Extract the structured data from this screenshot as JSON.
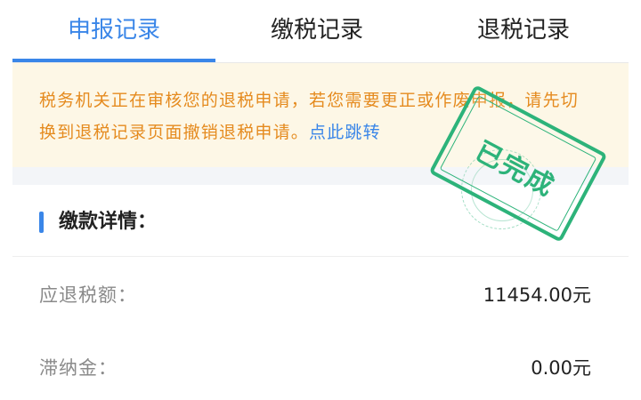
{
  "tabs": [
    {
      "label": "申报记录",
      "active": true
    },
    {
      "label": "缴税记录",
      "active": false
    },
    {
      "label": "退税记录",
      "active": false
    }
  ],
  "notice": {
    "text": "税务机关正在审核您的退税申请，若您需要更正或作废申报，请先切换到退税记录页面撤销退税申请。",
    "link": "点此跳转"
  },
  "stamp": {
    "text": "已完成"
  },
  "section": {
    "title": "缴款详情："
  },
  "rows": [
    {
      "label": "应退税额：",
      "value": "11454.00元"
    },
    {
      "label": "滞纳金：",
      "value": "0.00元"
    }
  ],
  "colors": {
    "accent": "#3a86e8",
    "warning": "#e58b1f",
    "stamp": "#2db37a",
    "notice_bg": "#fdf7e6"
  }
}
